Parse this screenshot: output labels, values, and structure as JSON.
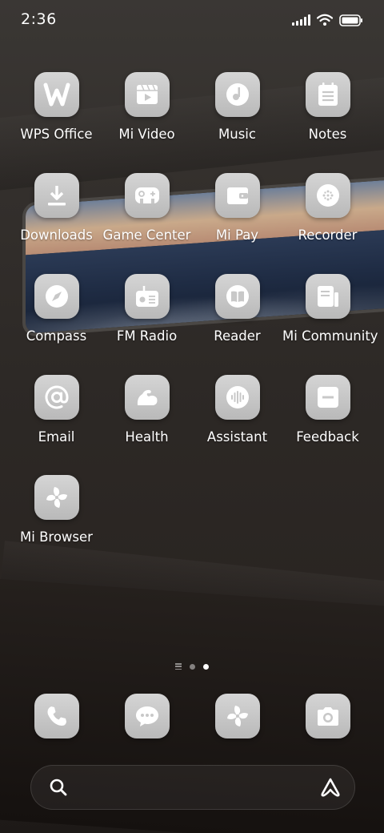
{
  "status_bar": {
    "time": "2:36"
  },
  "apps": [
    {
      "label": "WPS Office",
      "icon": "wps-office-icon"
    },
    {
      "label": "Mi Video",
      "icon": "video-icon"
    },
    {
      "label": "Music",
      "icon": "music-icon"
    },
    {
      "label": "Notes",
      "icon": "notes-icon"
    },
    {
      "label": "Downloads",
      "icon": "download-icon"
    },
    {
      "label": "Game Center",
      "icon": "gamepad-icon"
    },
    {
      "label": "Mi Pay",
      "icon": "wallet-icon"
    },
    {
      "label": "Recorder",
      "icon": "recorder-icon"
    },
    {
      "label": "Compass",
      "icon": "compass-icon"
    },
    {
      "label": "FM Radio",
      "icon": "radio-icon"
    },
    {
      "label": "Reader",
      "icon": "book-icon"
    },
    {
      "label": "Mi Community",
      "icon": "community-icon"
    },
    {
      "label": "Email",
      "icon": "email-icon"
    },
    {
      "label": "Health",
      "icon": "health-icon"
    },
    {
      "label": "Assistant",
      "icon": "assistant-icon"
    },
    {
      "label": "Feedback",
      "icon": "feedback-icon"
    },
    {
      "label": "Mi Browser",
      "icon": "browser-icon"
    }
  ],
  "dock": [
    {
      "name": "Phone",
      "icon": "phone-icon"
    },
    {
      "name": "Messages",
      "icon": "message-icon"
    },
    {
      "name": "Browser",
      "icon": "browser-icon"
    },
    {
      "name": "Camera",
      "icon": "camera-icon"
    }
  ],
  "page_indicator": {
    "pages": 2,
    "current": 2
  },
  "colors": {
    "icon_bg": "#c8c8c8",
    "glyph": "#ffffff",
    "text": "#ffffff"
  }
}
